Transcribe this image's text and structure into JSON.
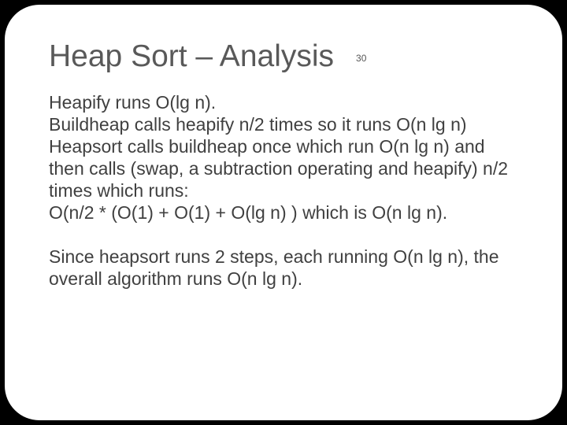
{
  "title": "Heap Sort – Analysis",
  "page_number": "30",
  "paragraphs": [
    "Heapify runs O(lg n).",
    "Buildheap calls heapify n/2 times so it runs O(n lg n)",
    "Heapsort calls buildheap once which run O(n lg n) and then calls (swap, a subtraction operating and heapify) n/2 times which runs:",
    "O(n/2 * (O(1) + O(1) + O(lg n) ) which is O(n lg n)."
  ],
  "conclusion": "Since heapsort runs 2 steps, each running O(n lg n), the overall algorithm runs O(n lg n)."
}
